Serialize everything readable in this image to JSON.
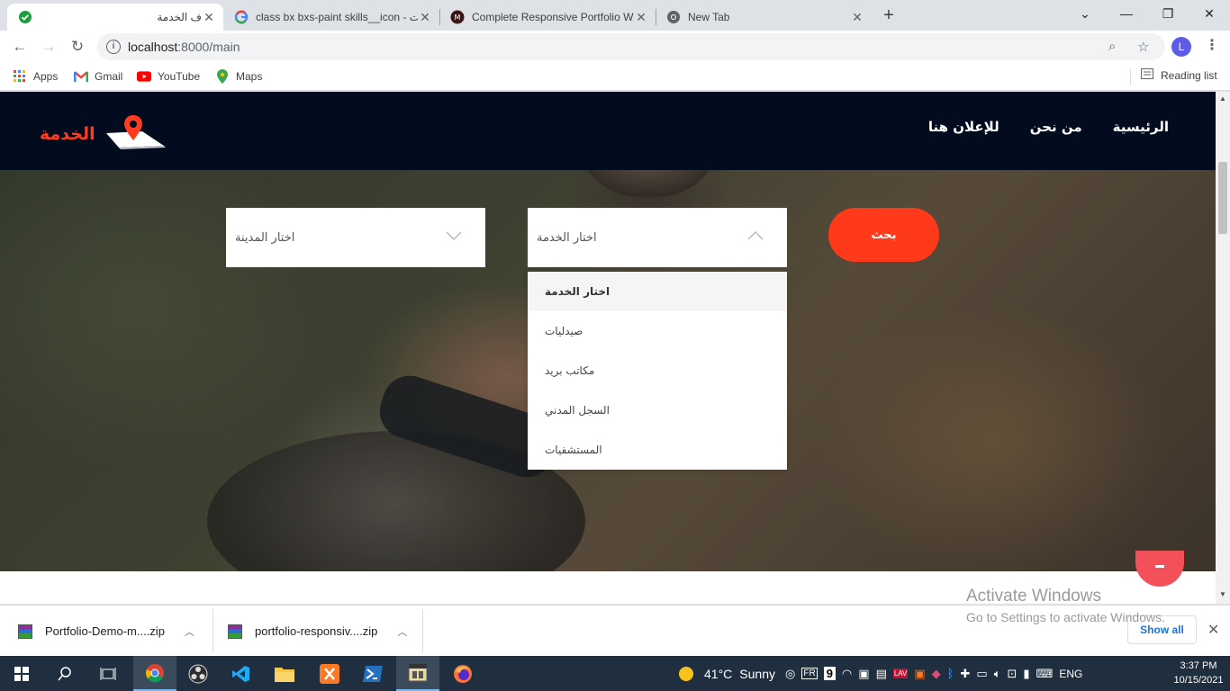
{
  "browser": {
    "tabs": [
      {
        "title": "ف الخدمة",
        "active": true,
        "icon": "check-circle-icon"
      },
      {
        "title": "class bx bxs-paint skills__icon - ت",
        "active": false,
        "icon": "google-icon"
      },
      {
        "title": "Complete Responsive Portfolio W",
        "active": false,
        "icon": "youtube-channel-icon"
      },
      {
        "title": "New Tab",
        "active": false,
        "icon": "chrome-icon"
      }
    ],
    "url_host": "localhost",
    "url_path": ":8000/main",
    "profile_initial": "L",
    "bookmarks": [
      {
        "label": "Apps",
        "icon": "apps-grid-icon"
      },
      {
        "label": "Gmail",
        "icon": "gmail-icon"
      },
      {
        "label": "YouTube",
        "icon": "youtube-icon"
      },
      {
        "label": "Maps",
        "icon": "maps-pin-icon"
      }
    ],
    "reading_list": "Reading list"
  },
  "site": {
    "logo_text": "الخدمة",
    "nav": [
      "للإعلان هنا",
      "من نحن",
      "الرئيسية"
    ],
    "city_select": {
      "label": "اختار المدينة",
      "state": "collapsed"
    },
    "service_select": {
      "label": "اختار الخدمة",
      "state": "open",
      "options": [
        "اختار الخدمة",
        "صيدليات",
        "مكاتب بريد",
        "السجل المدني",
        "المستشفيات"
      ],
      "selected_index": 0
    },
    "search_button": "بحث",
    "accent_color": "#ff3a1a",
    "header_color": "#030c1e"
  },
  "downloads": {
    "items": [
      {
        "name": "Portfolio-Demo-m....zip"
      },
      {
        "name": "portfolio-responsiv....zip"
      }
    ],
    "show_all": "Show all"
  },
  "watermark": {
    "line1": "Activate Windows",
    "line2": "Go to Settings to activate Windows."
  },
  "taskbar": {
    "weather_temp": "41°C",
    "weather_text": "Sunny",
    "language": "ENG",
    "time": "3:37 PM",
    "date": "10/15/2021",
    "tray_badge": "9"
  }
}
